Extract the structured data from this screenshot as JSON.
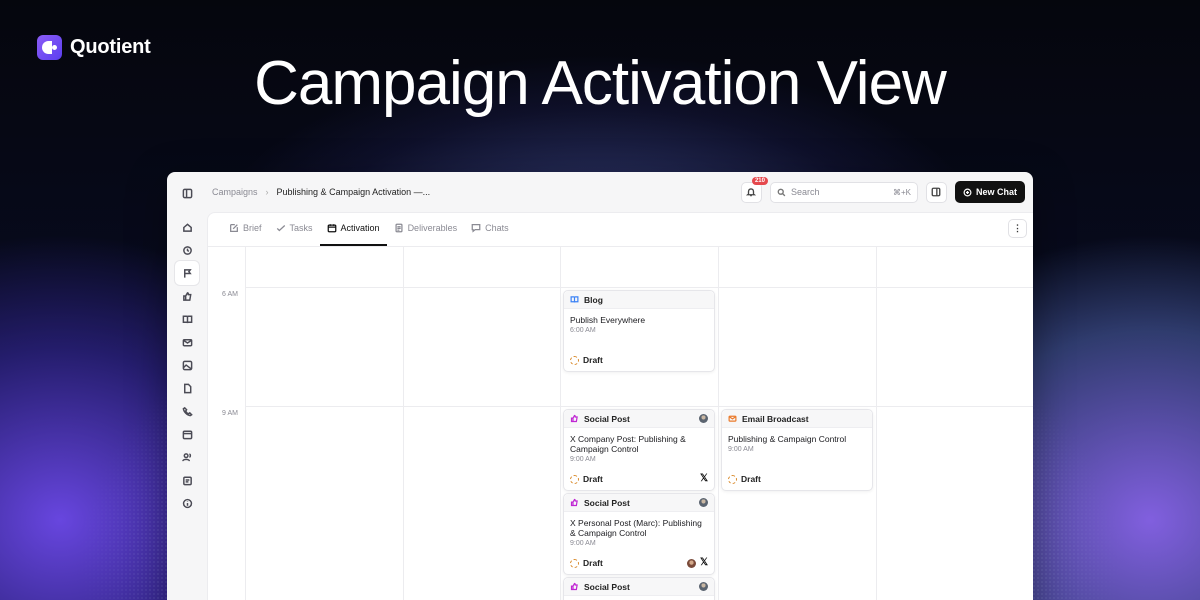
{
  "brand": {
    "name": "Quotient"
  },
  "headline": "Campaign Activation View",
  "colors": {
    "accent": "#8b5cf6",
    "badge": "#e5484d",
    "draft": "#d98a2b",
    "social": "#c026d3",
    "email": "#ea7a2b",
    "blog": "#3b82f6"
  },
  "topbar": {
    "breadcrumb_root": "Campaigns",
    "breadcrumb_sep": "›",
    "breadcrumb_current": "Publishing & Campaign Activation —...",
    "notification_count": "210",
    "search_placeholder": "Search",
    "search_shortcut": "⌘+K",
    "new_chat_label": "New Chat"
  },
  "rail_icons": [
    "sidebar-toggle-icon",
    "home-icon",
    "history-icon",
    "flag-icon",
    "thumbs-up-icon",
    "book-icon",
    "mail-icon",
    "image-icon",
    "file-icon",
    "phone-icon",
    "calendar-icon",
    "users-icon",
    "clipboard-icon",
    "info-icon"
  ],
  "tabs": [
    {
      "label": "Brief",
      "icon": "edit-icon"
    },
    {
      "label": "Tasks",
      "icon": "check-icon"
    },
    {
      "label": "Activation",
      "icon": "calendar-icon",
      "active": true
    },
    {
      "label": "Deliverables",
      "icon": "document-icon"
    },
    {
      "label": "Chats",
      "icon": "chat-icon"
    }
  ],
  "more_label": "⋮",
  "time_labels": {
    "t6": "6 AM",
    "t9": "9 AM"
  },
  "cards": {
    "blog": {
      "type": "Blog",
      "title": "Publish Everywhere",
      "time": "6:00 AM",
      "status": "Draft"
    },
    "social1": {
      "type": "Social Post",
      "title": "X Company Post: Publishing & Campaign Control",
      "time": "9:00 AM",
      "status": "Draft",
      "channel": "𝕏"
    },
    "email": {
      "type": "Email Broadcast",
      "title": "Publishing & Campaign Control",
      "time": "9:00 AM",
      "status": "Draft"
    },
    "social2": {
      "type": "Social Post",
      "title": "X Personal Post (Marc): Publishing & Campaign Control",
      "time": "9:00 AM",
      "status": "Draft",
      "channel": "𝕏"
    },
    "social3": {
      "type": "Social Post"
    }
  }
}
